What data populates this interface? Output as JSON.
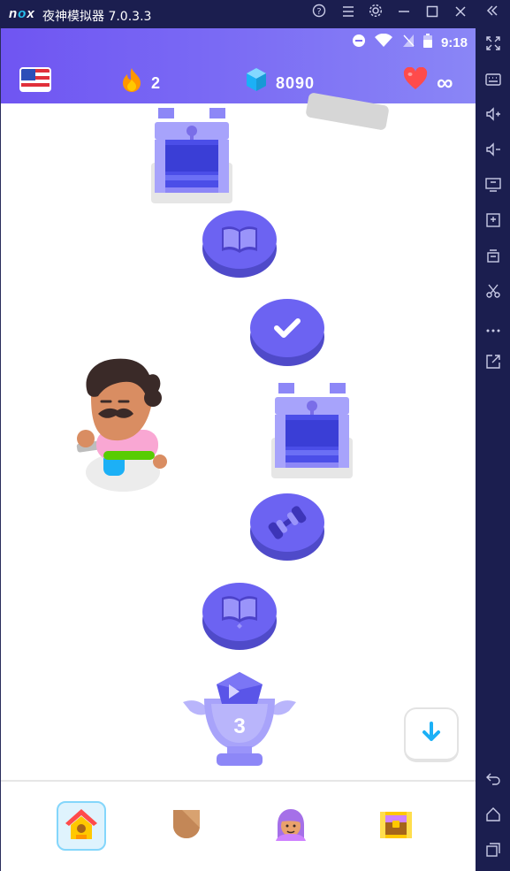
{
  "window": {
    "title": "夜神模拟器 7.0.3.3",
    "logo_n": "n",
    "logo_o": "o",
    "logo_x": "x"
  },
  "status_bar": {
    "time": "9:18"
  },
  "header": {
    "streak_count": "2",
    "gems_count": "8090",
    "hearts_value": "∞",
    "colors": {
      "streak": "#ff9600",
      "gems": "#1cb0f6",
      "hearts": "#ff4b4b"
    }
  },
  "path": {
    "trophy_level": "3",
    "nodes": [
      "chest",
      "lesson-book",
      "completed-check",
      "chest",
      "practice-dumbbell",
      "lesson-book",
      "trophy"
    ]
  },
  "bottom_nav": {
    "items": [
      "home",
      "leagues",
      "profile",
      "shop"
    ],
    "active": "home"
  },
  "sidebar": {
    "icons": [
      "fullscreen-icon",
      "keyboard-icon",
      "volume-up-icon",
      "volume-down-icon",
      "screen-icon",
      "apk-icon",
      "multi-instance-icon",
      "scissors-icon",
      "more-icon",
      "export-icon",
      "back-icon",
      "home-icon",
      "recents-icon"
    ]
  },
  "colors": {
    "header_start": "#6f55f2",
    "header_end": "#8a86f6",
    "node": "#6c63f2",
    "node_shadow": "#4f4ac9"
  }
}
